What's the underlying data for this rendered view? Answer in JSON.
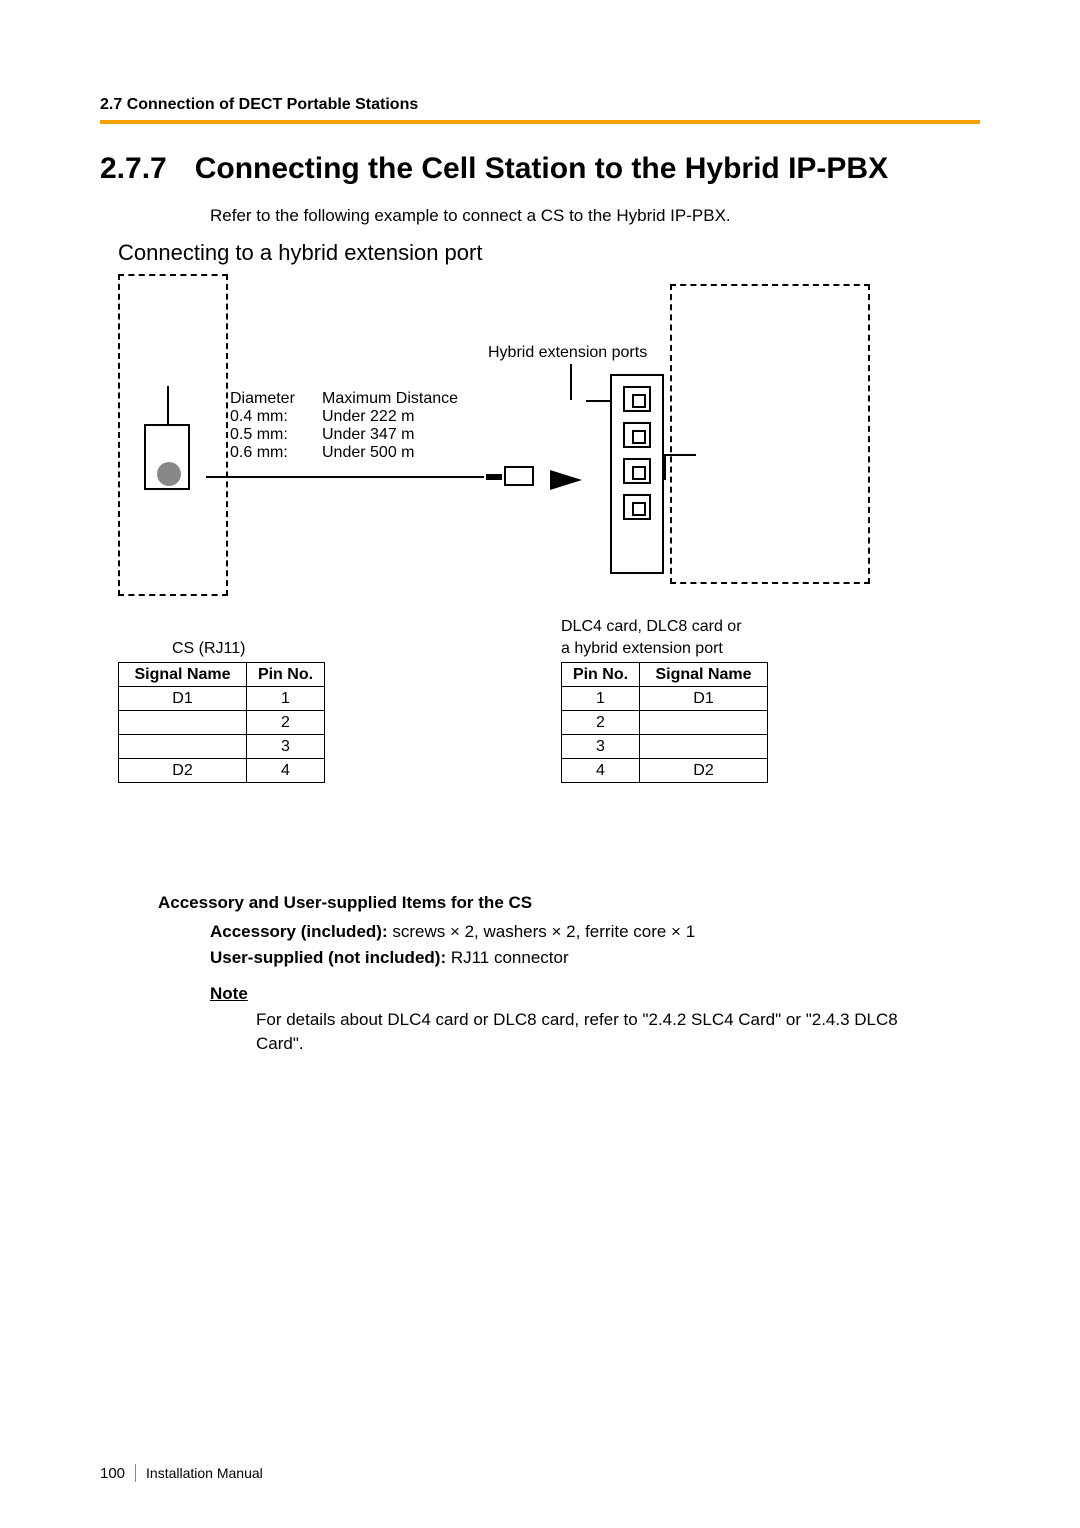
{
  "header": {
    "running": "2.7 Connection of DECT Portable Stations"
  },
  "title": {
    "number": "2.7.7",
    "text": "Connecting the Cell Station to the Hybrid IP-PBX"
  },
  "intro": "Refer to the following example to connect a CS to the Hybrid IP-PBX.",
  "subhead": "Connecting to a hybrid extension port",
  "diagram": {
    "ports_label": "Hybrid extension ports",
    "spec_head_diameter": "Diameter",
    "spec_head_maxdist": "Maximum Distance",
    "specs": [
      {
        "d": "0.4 mm:",
        "m": "Under 222 m"
      },
      {
        "d": "0.5 mm:",
        "m": "Under 347 m"
      },
      {
        "d": "0.6 mm:",
        "m": "Under 500 m"
      }
    ]
  },
  "tables": {
    "left_caption": "CS (RJ11)",
    "right_caption_l1": "DLC4 card, DLC8 card or",
    "right_caption_l2": "a hybrid extension port",
    "h_signal": "Signal Name",
    "h_pin": "Pin No.",
    "left": [
      {
        "sig": "D1",
        "pin": "1"
      },
      {
        "sig": "",
        "pin": "2"
      },
      {
        "sig": "",
        "pin": "3"
      },
      {
        "sig": "D2",
        "pin": "4"
      }
    ],
    "right": [
      {
        "pin": "1",
        "sig": "D1"
      },
      {
        "pin": "2",
        "sig": ""
      },
      {
        "pin": "3",
        "sig": ""
      },
      {
        "pin": "4",
        "sig": "D2"
      }
    ]
  },
  "items": {
    "heading": "Accessory and User-supplied Items for the CS",
    "acc_label": "Accessory (included):",
    "acc_value": " screws × 2, washers × 2, ferrite core × 1",
    "user_label": "User-supplied (not included):",
    "user_value": " RJ11 connector"
  },
  "note": {
    "label": "Note",
    "body": "For details about DLC4 card or DLC8 card, refer to \"2.4.2 SLC4 Card\" or \"2.4.3 DLC8 Card\"."
  },
  "footer": {
    "page": "100",
    "doc": "Installation Manual"
  }
}
